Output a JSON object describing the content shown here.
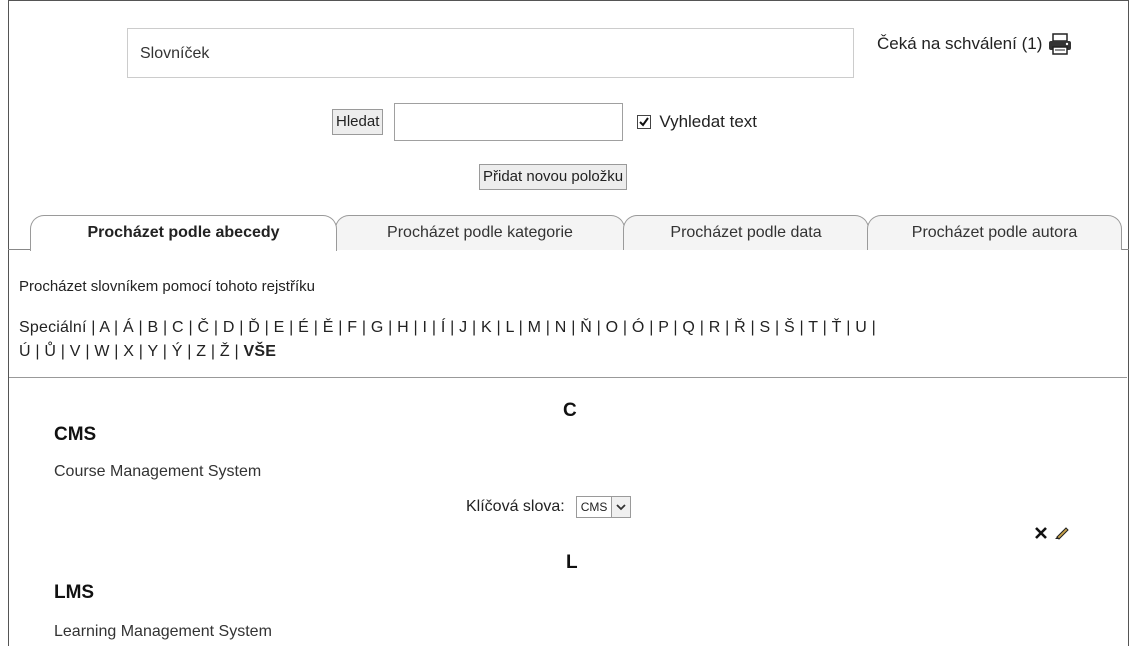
{
  "header": {
    "glossary_title": "Slovníček",
    "pending_label": "Čeká na schválení (1)",
    "printer_icon": "printer-icon"
  },
  "search": {
    "button_label": "Hledat",
    "input_value": "",
    "checkbox_checked": true,
    "checkbox_label": "Vyhledat text"
  },
  "add_entry_label": "Přidat novou položku",
  "tabs": [
    {
      "label": "Procházet podle abecedy",
      "active": true
    },
    {
      "label": "Procházet podle kategorie",
      "active": false
    },
    {
      "label": "Procházet podle data",
      "active": false
    },
    {
      "label": "Procházet podle autora",
      "active": false
    }
  ],
  "browse_note": "Procházet slovníkem pomocí tohoto rejstříku",
  "letters_line1": "Speciální | A | Á | B | C | Č | D | Ď | E | É | Ě | F | G | H | I | Í | J | K | L | M | N | Ň | O | Ó | P | Q | R | Ř | S | Š | T | Ť | U |",
  "letters_line2": "Ú | Ů | V | W | X | Y | Ý | Z | Ž | ",
  "letters_all": "VŠE",
  "sections": [
    {
      "letter": "C",
      "term": "CMS",
      "definition": "Course Management System",
      "keywords_label": "Klíčová slova:",
      "keyword_selected": "CMS"
    },
    {
      "letter": "L",
      "term": "LMS",
      "definition": "Learning Management System"
    }
  ],
  "colors": {
    "border": "#999999",
    "tab_bg": "#f4f4f4",
    "button_bg": "#ededed"
  }
}
